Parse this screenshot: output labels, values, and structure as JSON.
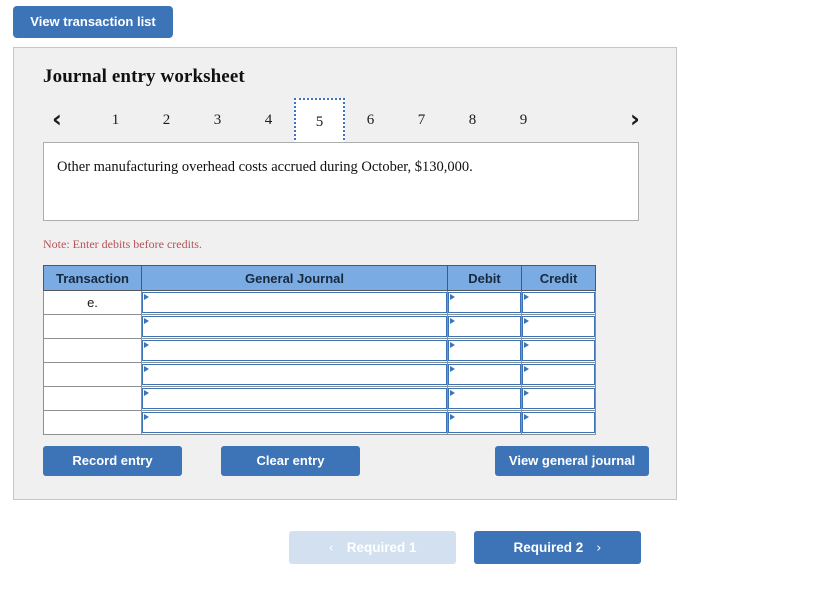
{
  "top_bar": {
    "view_transaction_list_label": "View transaction list"
  },
  "worksheet": {
    "title": "Journal entry worksheet",
    "pager": {
      "prev_icon": "‹",
      "next_icon": "›",
      "tabs": [
        "1",
        "2",
        "3",
        "4",
        "5",
        "6",
        "7",
        "8",
        "9"
      ],
      "active_tab": "5"
    },
    "prompt": "Other manufacturing overhead costs accrued during October, $130,000.",
    "note": "Note: Enter debits before credits.",
    "table": {
      "headers": [
        "Transaction",
        "General Journal",
        "Debit",
        "Credit"
      ],
      "rows": [
        {
          "transaction": "e.",
          "general_journal": "",
          "debit": "",
          "credit": ""
        },
        {
          "transaction": "",
          "general_journal": "",
          "debit": "",
          "credit": ""
        },
        {
          "transaction": "",
          "general_journal": "",
          "debit": "",
          "credit": ""
        },
        {
          "transaction": "",
          "general_journal": "",
          "debit": "",
          "credit": ""
        },
        {
          "transaction": "",
          "general_journal": "",
          "debit": "",
          "credit": ""
        },
        {
          "transaction": "",
          "general_journal": "",
          "debit": "",
          "credit": ""
        }
      ]
    },
    "actions": {
      "record_entry_label": "Record entry",
      "clear_entry_label": "Clear entry",
      "view_general_journal_label": "View general journal"
    }
  },
  "requirement_nav": {
    "prev_label": "Required 1",
    "prev_icon": "‹",
    "next_label": "Required 2",
    "next_icon": "›"
  },
  "colors": {
    "accent_blue": "#3d74b8",
    "header_blue": "#7aabe3",
    "disabled_blue": "#d3e0f0",
    "panel_bg": "#f0f0f0",
    "panel_border": "#c6c6c6",
    "note_red": "#b4545a"
  }
}
